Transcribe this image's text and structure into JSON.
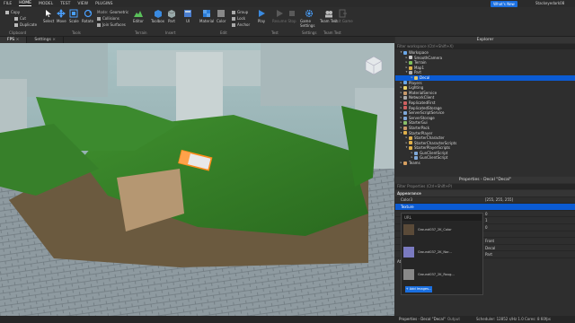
{
  "menubar": {
    "file": "FILE",
    "tabs": [
      "HOME",
      "MODEL",
      "TEST",
      "VIEW",
      "PLUGINS"
    ],
    "active_tab": "HOME"
  },
  "help_button": "What's New",
  "user": "Stackeyedark08",
  "ribbon": {
    "clipboard": {
      "copy": "Copy",
      "cut": "Cut",
      "duplicate": "Duplicate",
      "group": "Clipboard"
    },
    "tools": {
      "select": "Select",
      "move": "Move",
      "scale": "Scale",
      "rotate": "Rotate",
      "group": "Tools"
    },
    "mode": {
      "label": "Mode:",
      "value": "Geometric",
      "collisions": "Collisions",
      "join_surfaces": "Join Surfaces"
    },
    "terrain": {
      "editor": "Editor",
      "group": "Terrain"
    },
    "insert": {
      "toolbox": "Toolbox",
      "part": "Part",
      "ui": "UI",
      "group": "Insert"
    },
    "edit": {
      "material": "Material",
      "color": "Color",
      "group_label": "Group",
      "lock": "Lock",
      "anchor": "Anchor",
      "group": "Edit"
    },
    "test": {
      "play": "Play",
      "resume": "Resume",
      "stop": "Stop",
      "group": "Test"
    },
    "settings": {
      "game_settings": "Game Settings",
      "group": "Settings"
    },
    "team_test": {
      "team_test": "Team Test",
      "exit_game": "Exit Game",
      "group": "Team Test"
    }
  },
  "doc_tabs": [
    {
      "label": "FPS"
    },
    {
      "label": "Settings"
    }
  ],
  "explorer": {
    "title": "Explorer",
    "filter_placeholder": "Filter workspace (Ctrl+Shift+X)",
    "items": [
      {
        "label": "Workspace",
        "depth": 0,
        "expanded": true,
        "color": "#6aa7e8"
      },
      {
        "label": "SmoothCamera",
        "depth": 1,
        "color": "#c9c9c9"
      },
      {
        "label": "Terrain",
        "depth": 1,
        "color": "#7fbf5a"
      },
      {
        "label": "Map1",
        "depth": 1,
        "color": "#e0b04a"
      },
      {
        "label": "Part",
        "depth": 1,
        "expanded": true,
        "color": "#b0b0b0"
      },
      {
        "label": "Decal",
        "depth": 2,
        "color": "#e0c46a",
        "selected": true
      },
      {
        "label": "Players",
        "depth": 0,
        "color": "#6aa7e8"
      },
      {
        "label": "Lighting",
        "depth": 0,
        "color": "#e8d26a"
      },
      {
        "label": "MaterialService",
        "depth": 0,
        "color": "#c99a6a"
      },
      {
        "label": "NetworkClient",
        "depth": 0,
        "color": "#aaaaaa"
      },
      {
        "label": "ReplicatedFirst",
        "depth": 0,
        "color": "#d06060"
      },
      {
        "label": "ReplicatedStorage",
        "depth": 0,
        "color": "#d06060"
      },
      {
        "label": "ServerScriptService",
        "depth": 0,
        "color": "#7fa8d8"
      },
      {
        "label": "ServerStorage",
        "depth": 0,
        "color": "#7fa8d8"
      },
      {
        "label": "StarterGui",
        "depth": 0,
        "color": "#8ac06a"
      },
      {
        "label": "StarterPack",
        "depth": 0,
        "color": "#c99a6a"
      },
      {
        "label": "StarterPlayer",
        "depth": 0,
        "expanded": true,
        "color": "#e0b04a"
      },
      {
        "label": "StarterCharacter",
        "depth": 1,
        "color": "#e0b04a"
      },
      {
        "label": "StarterCharacterScripts",
        "depth": 1,
        "color": "#e0b04a"
      },
      {
        "label": "StarterPlayerScripts",
        "depth": 1,
        "expanded": true,
        "color": "#e0b04a"
      },
      {
        "label": "GunClientScript",
        "depth": 2,
        "color": "#7fa8d8"
      },
      {
        "label": "GunClientScript",
        "depth": 2,
        "color": "#7fa8d8"
      },
      {
        "label": "Teams",
        "depth": 0,
        "color": "#d8a060"
      }
    ]
  },
  "properties": {
    "title": "Properties - Decal \"Decal\"",
    "filter_placeholder": "Filter Properties (Ctrl+Shift+P)",
    "section": "Appearance",
    "rows": [
      {
        "key": "Color3",
        "value": "[255, 255, 255]"
      },
      {
        "key": "Texture",
        "value": "",
        "selected": true
      },
      {
        "key": "",
        "value": "0"
      },
      {
        "key": "",
        "value": "1"
      },
      {
        "key": "",
        "value": "0"
      },
      {
        "key": "",
        "value": ""
      },
      {
        "key": "",
        "value": "Front"
      },
      {
        "key": "",
        "value": "Decal"
      },
      {
        "key": "",
        "value": "Part"
      }
    ],
    "attributes": "Attributes",
    "url_label": "URL",
    "textures": [
      "Ground037_2K_Color",
      "Ground037_2K_Nor...",
      "Ground037_2K_Roug..."
    ],
    "add_button": "+ Add Images..."
  },
  "bottom_tabs": [
    "Properties - Decal \"Decal\"",
    "Output"
  ],
  "status": "Scheduler: 12852 s/Hz  1.0  Cores: 8  60fps"
}
